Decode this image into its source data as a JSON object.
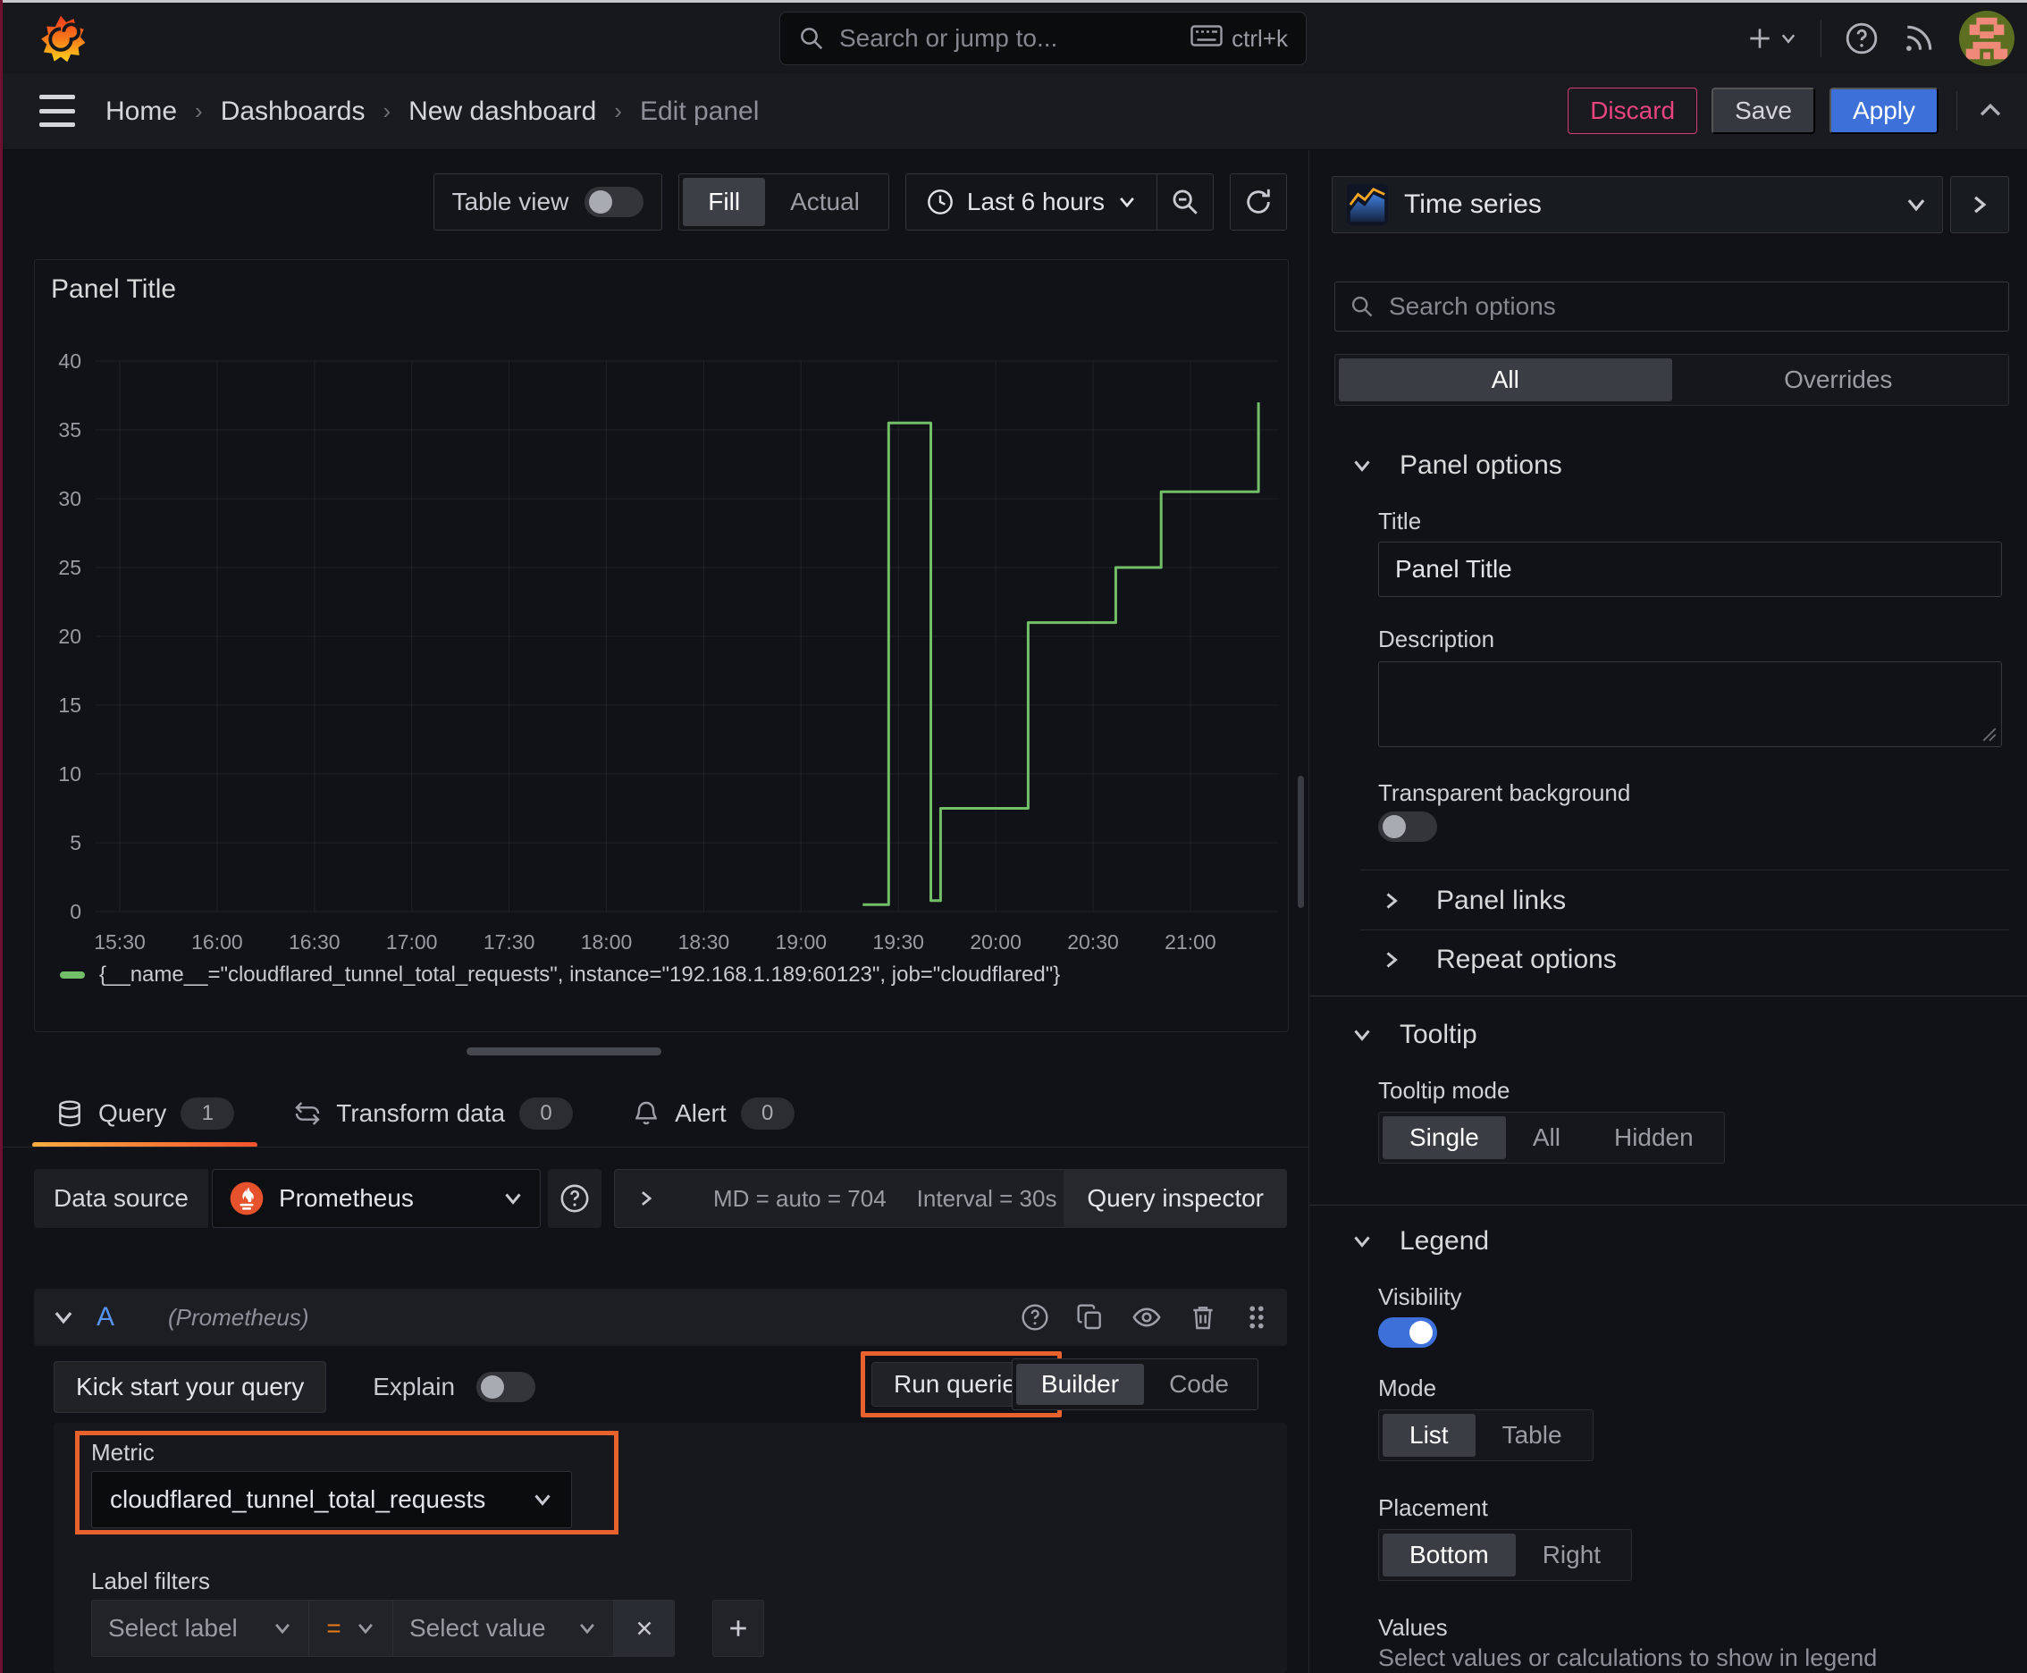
{
  "topbar": {
    "search_placeholder": "Search or jump to...",
    "search_shortcut": "ctrl+k"
  },
  "breadcrumb": {
    "items": [
      "Home",
      "Dashboards",
      "New dashboard",
      "Edit panel"
    ]
  },
  "header_actions": {
    "discard": "Discard",
    "save": "Save",
    "apply": "Apply"
  },
  "toolbar": {
    "table_view_label": "Table view",
    "fill_label": "Fill",
    "actual_label": "Actual",
    "time_range_label": "Last 6 hours"
  },
  "panel": {
    "title": "Panel Title",
    "legend_series": "{__name__=\"cloudflared_tunnel_total_requests\", instance=\"192.168.1.189:60123\", job=\"cloudflared\"}"
  },
  "chart_data": {
    "type": "line",
    "line_style": "step-after",
    "title": "Panel Title",
    "xlabel": "",
    "ylabel": "",
    "x_ticks": [
      "15:30",
      "16:00",
      "16:30",
      "17:00",
      "17:30",
      "18:00",
      "18:30",
      "19:00",
      "19:30",
      "20:00",
      "20:30",
      "21:00"
    ],
    "y_ticks": [
      40,
      35,
      30,
      25,
      20,
      15,
      10,
      5,
      0
    ],
    "ylim": [
      0,
      40
    ],
    "grid": true,
    "legend_position": "bottom",
    "series": [
      {
        "name": "{__name__=\"cloudflared_tunnel_total_requests\", instance=\"192.168.1.189:60123\", job=\"cloudflared\"}",
        "color": "#73bf69",
        "points": [
          [
            "19:19",
            0.5
          ],
          [
            "19:27",
            0.5
          ],
          [
            "19:27",
            35.5
          ],
          [
            "19:40",
            35.5
          ],
          [
            "19:40",
            0.8
          ],
          [
            "19:43",
            0.8
          ],
          [
            "19:43",
            7.5
          ],
          [
            "20:10",
            7.5
          ],
          [
            "20:10",
            21.0
          ],
          [
            "20:37",
            21.0
          ],
          [
            "20:37",
            25.0
          ],
          [
            "20:51",
            25.0
          ],
          [
            "20:51",
            30.5
          ],
          [
            "21:21",
            30.5
          ],
          [
            "21:21",
            37.0
          ]
        ]
      }
    ]
  },
  "query_tabs": {
    "query": {
      "label": "Query",
      "badge": "1"
    },
    "transform": {
      "label": "Transform data",
      "badge": "0"
    },
    "alert": {
      "label": "Alert",
      "badge": "0"
    }
  },
  "datasource_row": {
    "label": "Data source",
    "value": "Prometheus",
    "options_summary_md": "MD = auto = 704",
    "options_summary_interval": "Interval = 30s",
    "inspector_label": "Query inspector"
  },
  "query_editor": {
    "ref_id": "A",
    "datasource_hint": "(Prometheus)",
    "kick_start_label": "Kick start your query",
    "explain_label": "Explain",
    "run_queries_label": "Run queries",
    "builder_label": "Builder",
    "code_label": "Code",
    "metric_label": "Metric",
    "metric_value": "cloudflared_tunnel_total_requests",
    "label_filters_label": "Label filters",
    "select_label_placeholder": "Select label",
    "operator_value": "=",
    "select_value_placeholder": "Select value"
  },
  "sidebar": {
    "viz_picker_label": "Time series",
    "search_placeholder": "Search options",
    "filter_tabs": {
      "all": "All",
      "overrides": "Overrides"
    },
    "panel_options": {
      "heading": "Panel options",
      "title_label": "Title",
      "title_value": "Panel Title",
      "description_label": "Description",
      "description_value": "",
      "transparent_label": "Transparent background",
      "panel_links_label": "Panel links",
      "repeat_options_label": "Repeat options"
    },
    "tooltip": {
      "heading": "Tooltip",
      "mode_label": "Tooltip mode",
      "mode_single": "Single",
      "mode_all": "All",
      "mode_hidden": "Hidden"
    },
    "legend": {
      "heading": "Legend",
      "visibility_label": "Visibility",
      "mode_label": "Mode",
      "mode_list": "List",
      "mode_table": "Table",
      "placement_label": "Placement",
      "placement_bottom": "Bottom",
      "placement_right": "Right",
      "values_label": "Values",
      "values_help": "Select values or calculations to show in legend"
    }
  },
  "colors": {
    "highlight_orange": "#e8622d",
    "series_green": "#73bf69",
    "primary_blue": "#3d71d9",
    "danger_pink": "#e8447e",
    "tab_underline_from": "#fbad41",
    "tab_underline_to": "#f2542d"
  }
}
